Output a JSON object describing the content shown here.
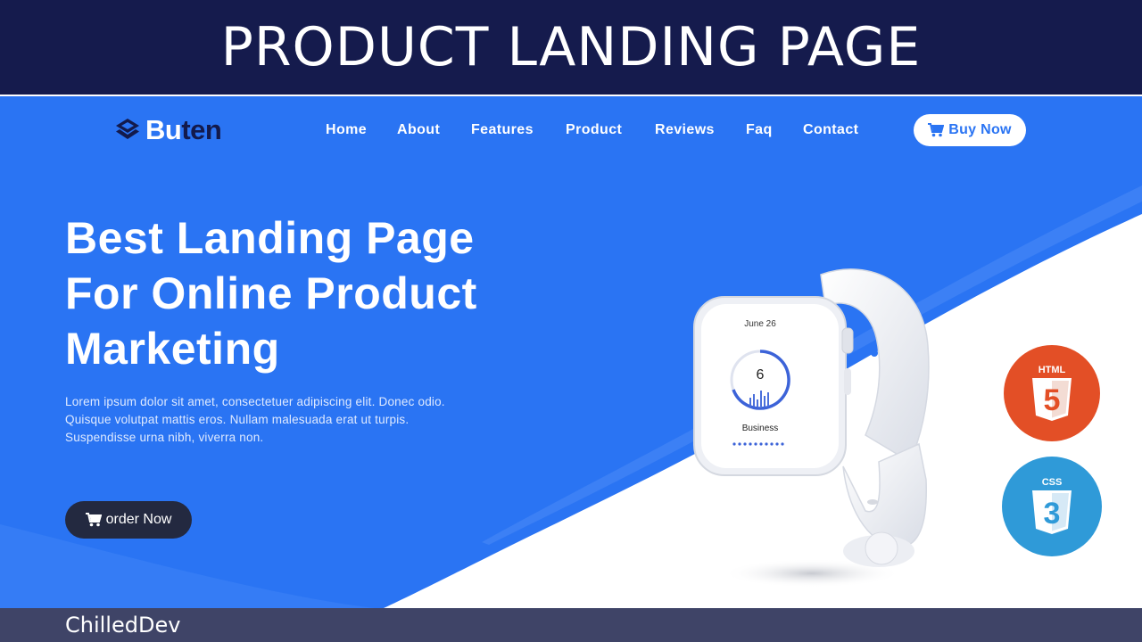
{
  "banner": {
    "title": "PRODUCT LANDING PAGE"
  },
  "brand": {
    "name_light": "Bu",
    "name_dark": "ten"
  },
  "nav": {
    "items": [
      {
        "label": "Home"
      },
      {
        "label": "About"
      },
      {
        "label": "Features"
      },
      {
        "label": "Product"
      },
      {
        "label": "Reviews"
      },
      {
        "label": "Faq"
      },
      {
        "label": "Contact"
      }
    ],
    "buy_label": "Buy Now"
  },
  "hero": {
    "title_line1": "Best Landing Page",
    "title_line2": "For Online Product",
    "title_line3": "Marketing",
    "text_line1": "Lorem ipsum dolor sit amet, consectetuer adipiscing elit. Donec odio.",
    "text_line2": "Quisque volutpat mattis eros. Nullam malesuada erat ut turpis.",
    "text_line3": "Suspendisse urna nibh, viverra non.",
    "order_label": "order Now"
  },
  "watch": {
    "date": "June 26",
    "number": "6",
    "label": "Business"
  },
  "tech": {
    "html_label": "HTML",
    "html_digit": "5",
    "css_label": "CSS",
    "css_digit": "3"
  },
  "footer": {
    "credit": "ChilledDev"
  },
  "colors": {
    "banner": "#151b4d",
    "hero_blue": "#2a74f3",
    "html_orange": "#e34f26",
    "css_blue": "#2f9ad8",
    "button_dark": "#232940",
    "footer": "#3f4467"
  },
  "icons": [
    "brand-logo-icon",
    "cart-icon",
    "html5-icon",
    "css3-icon"
  ]
}
